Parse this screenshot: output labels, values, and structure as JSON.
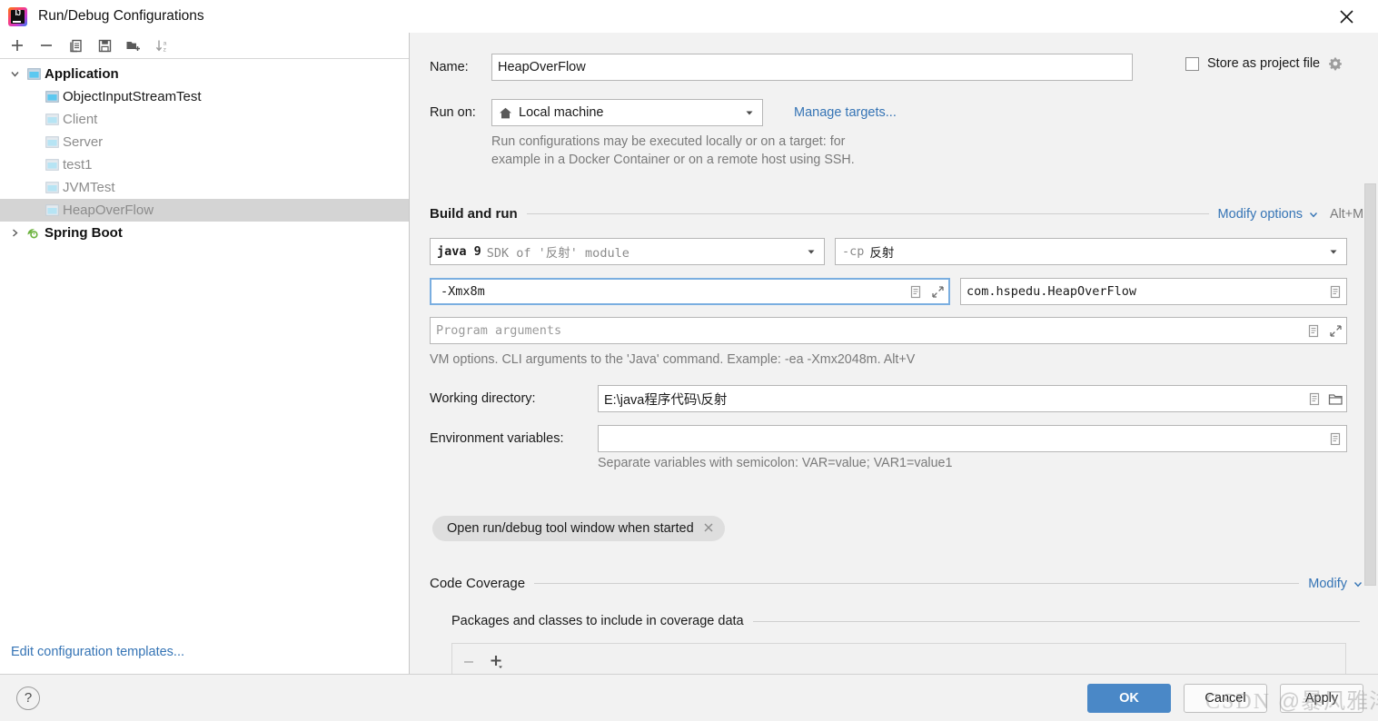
{
  "window": {
    "title": "Run/Debug Configurations",
    "app_icon": "intellij-idea-logo",
    "close_icon": "close-icon"
  },
  "sidebar": {
    "toolbar": [
      {
        "name": "add-configuration-button",
        "icon": "plus-icon",
        "label": "+"
      },
      {
        "name": "remove-configuration-button",
        "icon": "minus-icon",
        "label": "−"
      },
      {
        "name": "copy-configuration-button",
        "icon": "copy-icon",
        "label": "Copy"
      },
      {
        "name": "save-configuration-button",
        "icon": "save-icon",
        "label": "Save"
      },
      {
        "name": "new-folder-button",
        "icon": "new-folder-icon",
        "label": "New Folder"
      },
      {
        "name": "sort-configurations-button",
        "icon": "sort-alphabetical-icon",
        "label": "Sort"
      }
    ],
    "tree": [
      {
        "label": "Application",
        "icon": "application-icon",
        "arrow": "chevron-down-icon",
        "level": 0,
        "style": "bold",
        "selected": false
      },
      {
        "label": "ObjectInputStreamTest",
        "icon": "application-icon",
        "arrow": "",
        "level": 1,
        "style": "normal",
        "selected": false
      },
      {
        "label": "Client",
        "icon": "application-icon",
        "arrow": "",
        "level": 1,
        "style": "dim",
        "selected": false
      },
      {
        "label": "Server",
        "icon": "application-icon",
        "arrow": "",
        "level": 1,
        "style": "dim",
        "selected": false
      },
      {
        "label": "test1",
        "icon": "application-icon",
        "arrow": "",
        "level": 1,
        "style": "dim",
        "selected": false
      },
      {
        "label": "JVMTest",
        "icon": "application-icon",
        "arrow": "",
        "level": 1,
        "style": "dim",
        "selected": false
      },
      {
        "label": "HeapOverFlow",
        "icon": "application-icon",
        "arrow": "",
        "level": 1,
        "style": "dim",
        "selected": true
      },
      {
        "label": "Spring Boot",
        "icon": "spring-boot-icon",
        "arrow": "chevron-right-icon",
        "level": 0,
        "style": "bold",
        "selected": false
      }
    ],
    "edit_templates_link": "Edit configuration templates..."
  },
  "form": {
    "name_label": "Name:",
    "name_value": "HeapOverFlow",
    "store_as_project_file_label": "Store as project file",
    "store_as_project_file_checked": false,
    "store_gear_icon": "gear-icon",
    "run_on_label": "Run on:",
    "run_on_value": "Local machine",
    "run_on_icon": "home-icon",
    "manage_targets_link": "Manage targets...",
    "run_on_hint_line1": "Run configurations may be executed locally or on a target: for",
    "run_on_hint_line2": "example in a Docker Container or on a remote host using SSH."
  },
  "build_and_run": {
    "section_title": "Build and run",
    "modify_options_link": "Modify options",
    "modify_options_shortcut": "Alt+M",
    "jdk_value_bold": "java 9",
    "jdk_value_rest": "SDK of '反射' module",
    "classpath_value_prefix": "-cp",
    "classpath_value_rest": "反射",
    "vm_options_value": "-Xmx8m",
    "vm_options_focused": true,
    "main_class_value": "com.hspedu.HeapOverFlow",
    "program_arguments_placeholder": "Program arguments",
    "program_arguments_value": "",
    "vm_options_hint": "VM options. CLI arguments to the 'Java' command. Example: -ea -Xmx2048m. Alt+V",
    "macro_icon": "insert-macro-icon",
    "expand_icon": "expand-icon"
  },
  "directories": {
    "working_directory_label": "Working directory:",
    "working_directory_value": "E:\\java程序代码\\反射",
    "browse_icon": "folder-browse-icon",
    "environment_variables_label": "Environment variables:",
    "environment_variables_value": "",
    "environment_hint": "Separate variables with semicolon: VAR=value; VAR1=value1"
  },
  "options_chip": {
    "label": "Open run/debug tool window when started",
    "remove_icon": "close-small-icon"
  },
  "code_coverage": {
    "section_title": "Code Coverage",
    "modify_link": "Modify",
    "packages_title": "Packages and classes to include in coverage data",
    "remove_button_icon": "minus-icon",
    "add_button_icon": "plus-dropdown-icon"
  },
  "footer": {
    "help_label": "?",
    "ok_label": "OK",
    "cancel_label": "Cancel",
    "apply_label": "Apply"
  },
  "watermark": {
    "prefix": "CSDN",
    "handle": "@暴风雅洋塔"
  },
  "colors": {
    "accent_blue": "#4a88c7",
    "link_blue": "#3574b5",
    "selection_gray": "#d4d4d4",
    "panel_bg": "#f2f2f2"
  }
}
